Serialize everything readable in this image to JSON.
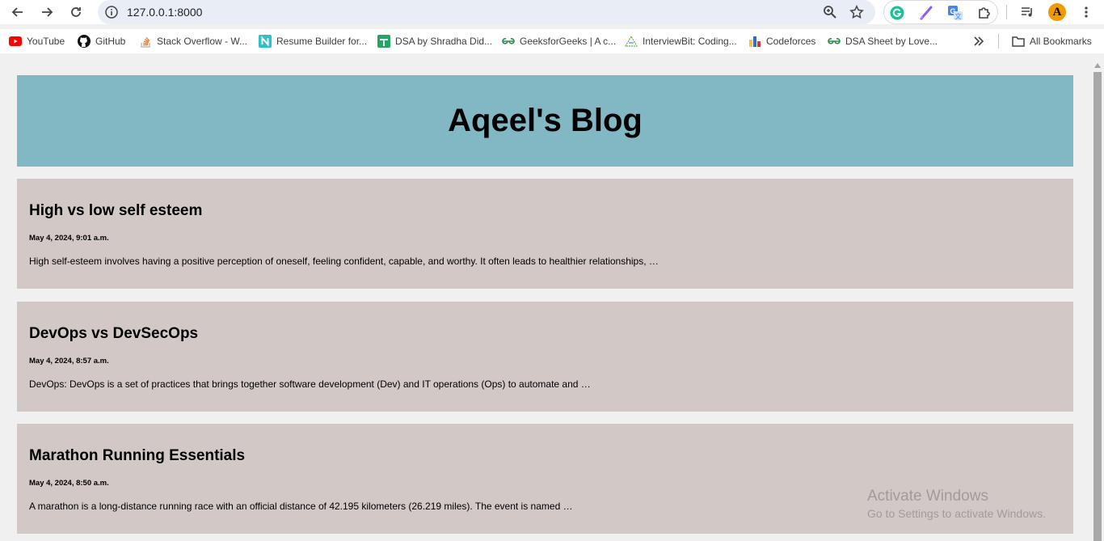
{
  "browser": {
    "url": "127.0.0.1:8000",
    "bookmarks": [
      {
        "label": "YouTube",
        "icon": "youtube-icon"
      },
      {
        "label": "GitHub",
        "icon": "github-icon"
      },
      {
        "label": "Stack Overflow - W...",
        "icon": "stackoverflow-icon"
      },
      {
        "label": "Resume Builder for...",
        "icon": "resume-builder-icon"
      },
      {
        "label": "DSA by Shradha Did...",
        "icon": "sheets-icon"
      },
      {
        "label": "GeeksforGeeks | A c...",
        "icon": "geeksforgeeks-icon"
      },
      {
        "label": "InterviewBit: Coding...",
        "icon": "interviewbit-icon"
      },
      {
        "label": "Codeforces",
        "icon": "codeforces-icon"
      },
      {
        "label": "DSA Sheet by Love...",
        "icon": "geeksforgeeks-icon"
      }
    ],
    "all_bookmarks": "All Bookmarks",
    "profile_initial": "A"
  },
  "blog": {
    "title": "Aqeel's Blog",
    "posts": [
      {
        "title": "High vs low self esteem",
        "date": "May 4, 2024, 9:01 a.m.",
        "excerpt": "High self-esteem involves having a positive perception of oneself, feeling confident, capable, and worthy. It often leads to healthier relationships, …"
      },
      {
        "title": "DevOps vs DevSecOps",
        "date": "May 4, 2024, 8:57 a.m.",
        "excerpt": "DevOps: DevOps is a set of practices that brings together software development (Dev) and IT operations (Ops) to automate and …"
      },
      {
        "title": "Marathon Running Essentials",
        "date": "May 4, 2024, 8:50 a.m.",
        "excerpt": "A marathon is a long-distance running race with an official distance of 42.195 kilometers (26.219 miles). The event is named …"
      }
    ]
  },
  "watermark": {
    "line1": "Activate Windows",
    "line2": "Go to Settings to activate Windows."
  },
  "colors": {
    "header_bg": "#82b8c4",
    "post_bg": "#d2c8c6",
    "page_bg": "#f0f0f0"
  }
}
